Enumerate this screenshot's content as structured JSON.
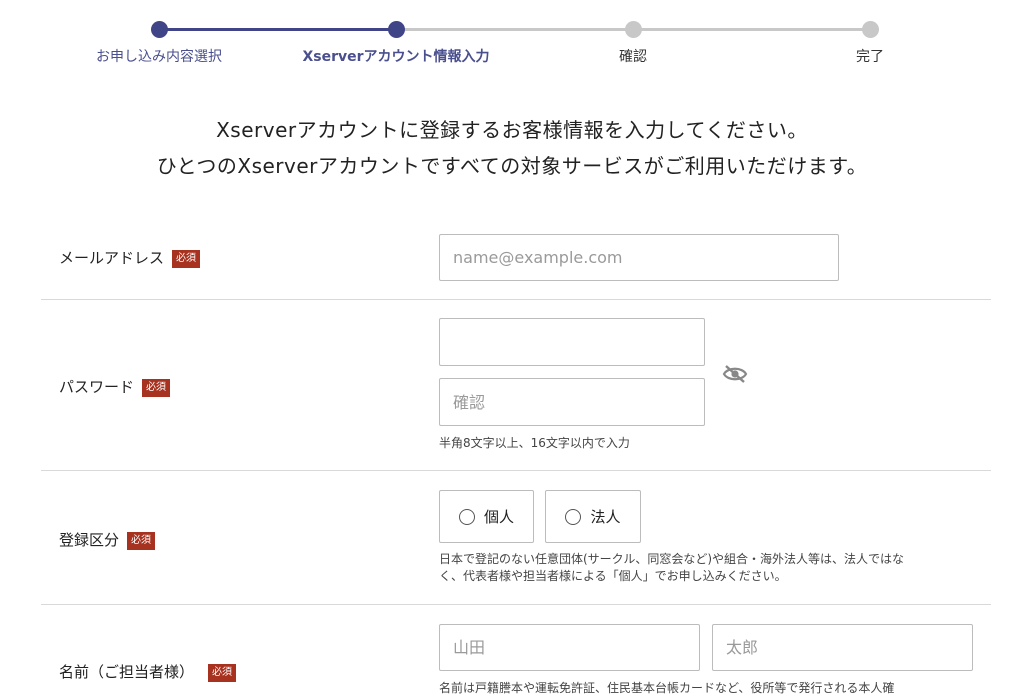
{
  "stepper": {
    "steps": [
      {
        "label": "お申し込み内容選択",
        "state": "done"
      },
      {
        "label": "Xserverアカウント情報入力",
        "state": "current"
      },
      {
        "label": "確認",
        "state": "todo"
      },
      {
        "label": "完了",
        "state": "todo"
      }
    ],
    "colors": {
      "active": "#3f4587",
      "inactive": "#c8c8c8"
    }
  },
  "intro": {
    "line1": "Xserverアカウントに登録するお客様情報を入力してください。",
    "line2": "ひとつのXserverアカウントですべての対象サービスがご利用いただけます。"
  },
  "form": {
    "required_badge": "必須",
    "email": {
      "label": "メールアドレス",
      "placeholder": "name@example.com",
      "value": ""
    },
    "password": {
      "label": "パスワード",
      "placeholder": "",
      "confirm_placeholder": "確認",
      "hint": "半角8文字以上、16文字以内で入力",
      "toggle_icon": "eye-slash-icon"
    },
    "registration_type": {
      "label": "登録区分",
      "options": [
        "個人",
        "法人"
      ],
      "hint_line1": "日本で登記のない任意団体(サークル、同窓会など)や組合・海外法人等は、法人ではな",
      "hint_line2": "く、代表者様や担当者様による「個人」でお申し込みください。"
    },
    "name": {
      "label": "名前（ご担当者様）",
      "last_placeholder": "山田",
      "first_placeholder": "太郎",
      "hint": "名前は戸籍謄本や運転免許証、住民基本台帳カードなど、役所等で発行される本人確"
    }
  },
  "accent_colors": {
    "required": "#a83220",
    "stepper_active": "#3f4587"
  }
}
